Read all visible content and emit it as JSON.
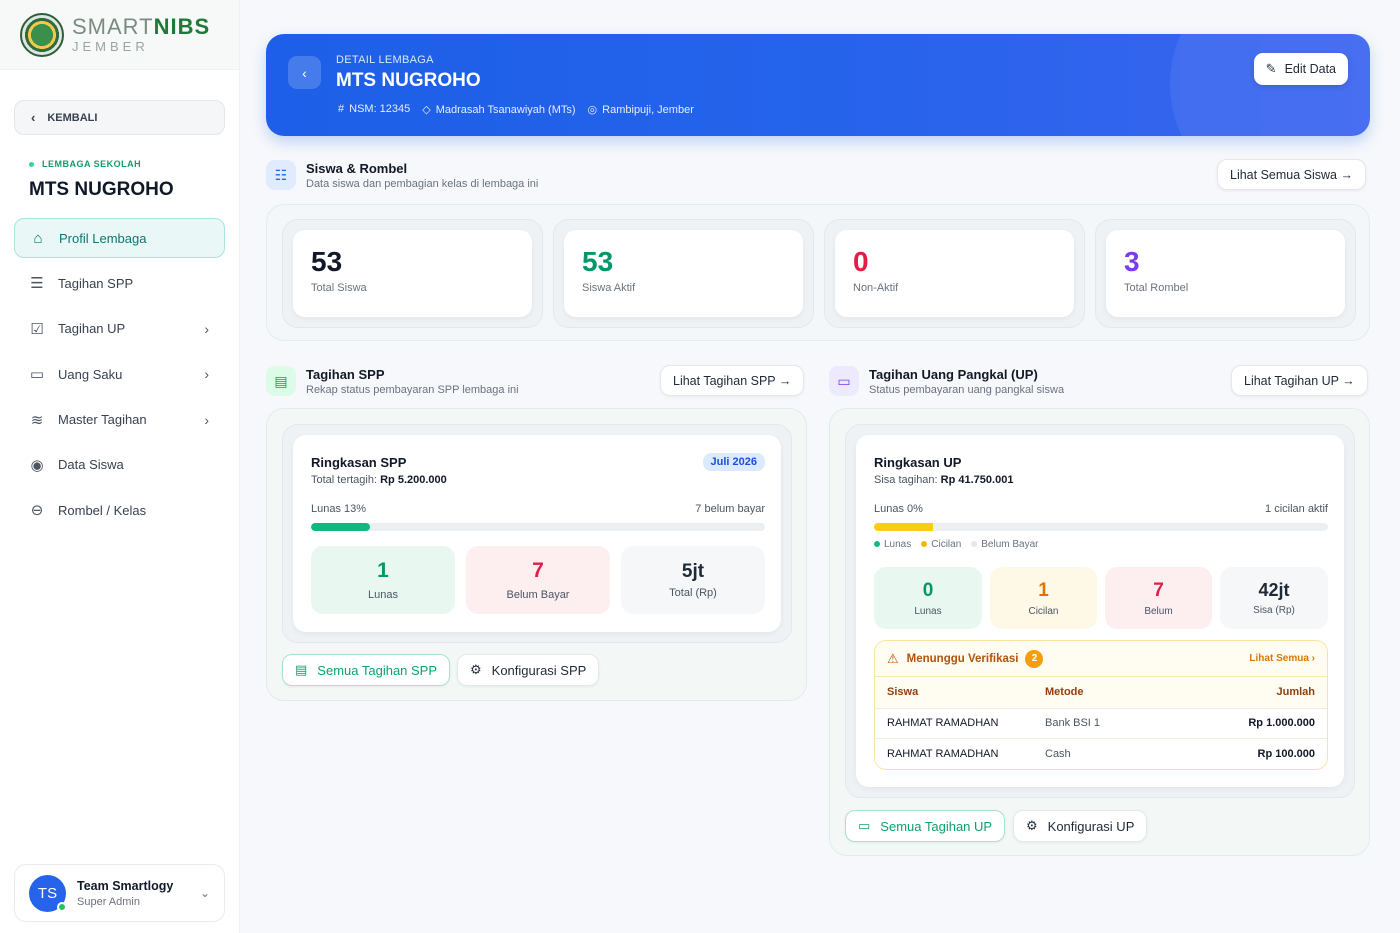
{
  "brand": {
    "name_light": "SMART",
    "name_bold": "NIBS",
    "sub": "JEMBER"
  },
  "sidebar": {
    "back_label": "KEMBALI",
    "section_label": "LEMBAGA SEKOLAH",
    "section_title": "MTS NUGROHO",
    "items": [
      {
        "label": "Profil Lembaga",
        "icon": "school-icon",
        "active": true
      },
      {
        "label": "Tagihan SPP",
        "icon": "receipt-icon"
      },
      {
        "label": "Tagihan UP",
        "icon": "checklist-icon",
        "has_submenu": true
      },
      {
        "label": "Uang Saku",
        "icon": "wallet-icon",
        "has_submenu": true
      },
      {
        "label": "Master Tagihan",
        "icon": "layers-icon",
        "has_submenu": true
      },
      {
        "label": "Data Siswa",
        "icon": "user-badge-icon"
      },
      {
        "label": "Rombel / Kelas",
        "icon": "classroom-icon"
      }
    ],
    "user": {
      "initials": "TS",
      "name": "Team Smartlogy",
      "role": "Super Admin"
    }
  },
  "header": {
    "kicker": "DETAIL LEMBAGA",
    "title": "MTS NUGROHO",
    "nsm": "NSM: 12345",
    "type": "Madrasah Tsanawiyah (MTs)",
    "location": "Rambipuji, Jember",
    "edit_label": "Edit Data"
  },
  "siswa_section": {
    "title": "Siswa & Rombel",
    "desc": "Data siswa dan pembagian kelas di lembaga ini",
    "button": "Lihat Semua Siswa →",
    "stats": [
      {
        "value": "53",
        "label": "Total Siswa",
        "color": "#111827"
      },
      {
        "value": "53",
        "label": "Siswa Aktif",
        "color": "#059669"
      },
      {
        "value": "0",
        "label": "Non-Aktif",
        "color": "#e11d48"
      },
      {
        "value": "3",
        "label": "Total Rombel",
        "color": "#7c3aed"
      }
    ]
  },
  "spp": {
    "title": "Tagihan SPP",
    "desc": "Rekap status pembayaran SPP lembaga ini",
    "button": "Lihat Tagihan SPP →",
    "card_title": "Ringkasan SPP",
    "total_label": "Total tertagih:",
    "total_value": "Rp 5.200.000",
    "period": "Juli 2026",
    "progress_label": "Lunas 13%",
    "progress_right": "7 belum bayar",
    "progress_fraction": 0.13,
    "tiles": [
      {
        "value": "1",
        "label": "Lunas"
      },
      {
        "value": "7",
        "label": "Belum Bayar"
      },
      {
        "value": "5jt",
        "label": "Total (Rp)"
      }
    ],
    "btn_all": "Semua Tagihan SPP",
    "btn_config": "Konfigurasi SPP"
  },
  "up": {
    "title": "Tagihan Uang Pangkal (UP)",
    "desc": "Status pembayaran uang pangkal siswa",
    "button": "Lihat Tagihan UP →",
    "card_title": "Ringkasan UP",
    "sisa_label": "Sisa tagihan:",
    "sisa_value": "Rp 41.750.001",
    "progress_label": "Lunas 0%",
    "progress_right": "1 cicilan aktif",
    "progress_fraction_cicilan": 0.13,
    "legend": [
      "Lunas",
      "Cicilan",
      "Belum Bayar"
    ],
    "tiles": [
      {
        "value": "0",
        "label": "Lunas"
      },
      {
        "value": "1",
        "label": "Cicilan"
      },
      {
        "value": "7",
        "label": "Belum"
      },
      {
        "value": "42jt",
        "label": "Sisa (Rp)"
      }
    ],
    "verif": {
      "title": "Menunggu Verifikasi",
      "count": "2",
      "link": "Lihat Semua ›",
      "columns": [
        "Siswa",
        "Metode",
        "Jumlah"
      ],
      "rows": [
        {
          "siswa": "RAHMAT RAMADHAN",
          "metode": "Bank BSI 1",
          "jumlah": "Rp 1.000.000"
        },
        {
          "siswa": "RAHMAT RAMADHAN",
          "metode": "Cash",
          "jumlah": "Rp 100.000"
        }
      ]
    },
    "btn_all": "Semua Tagihan UP",
    "btn_config": "Konfigurasi UP"
  }
}
